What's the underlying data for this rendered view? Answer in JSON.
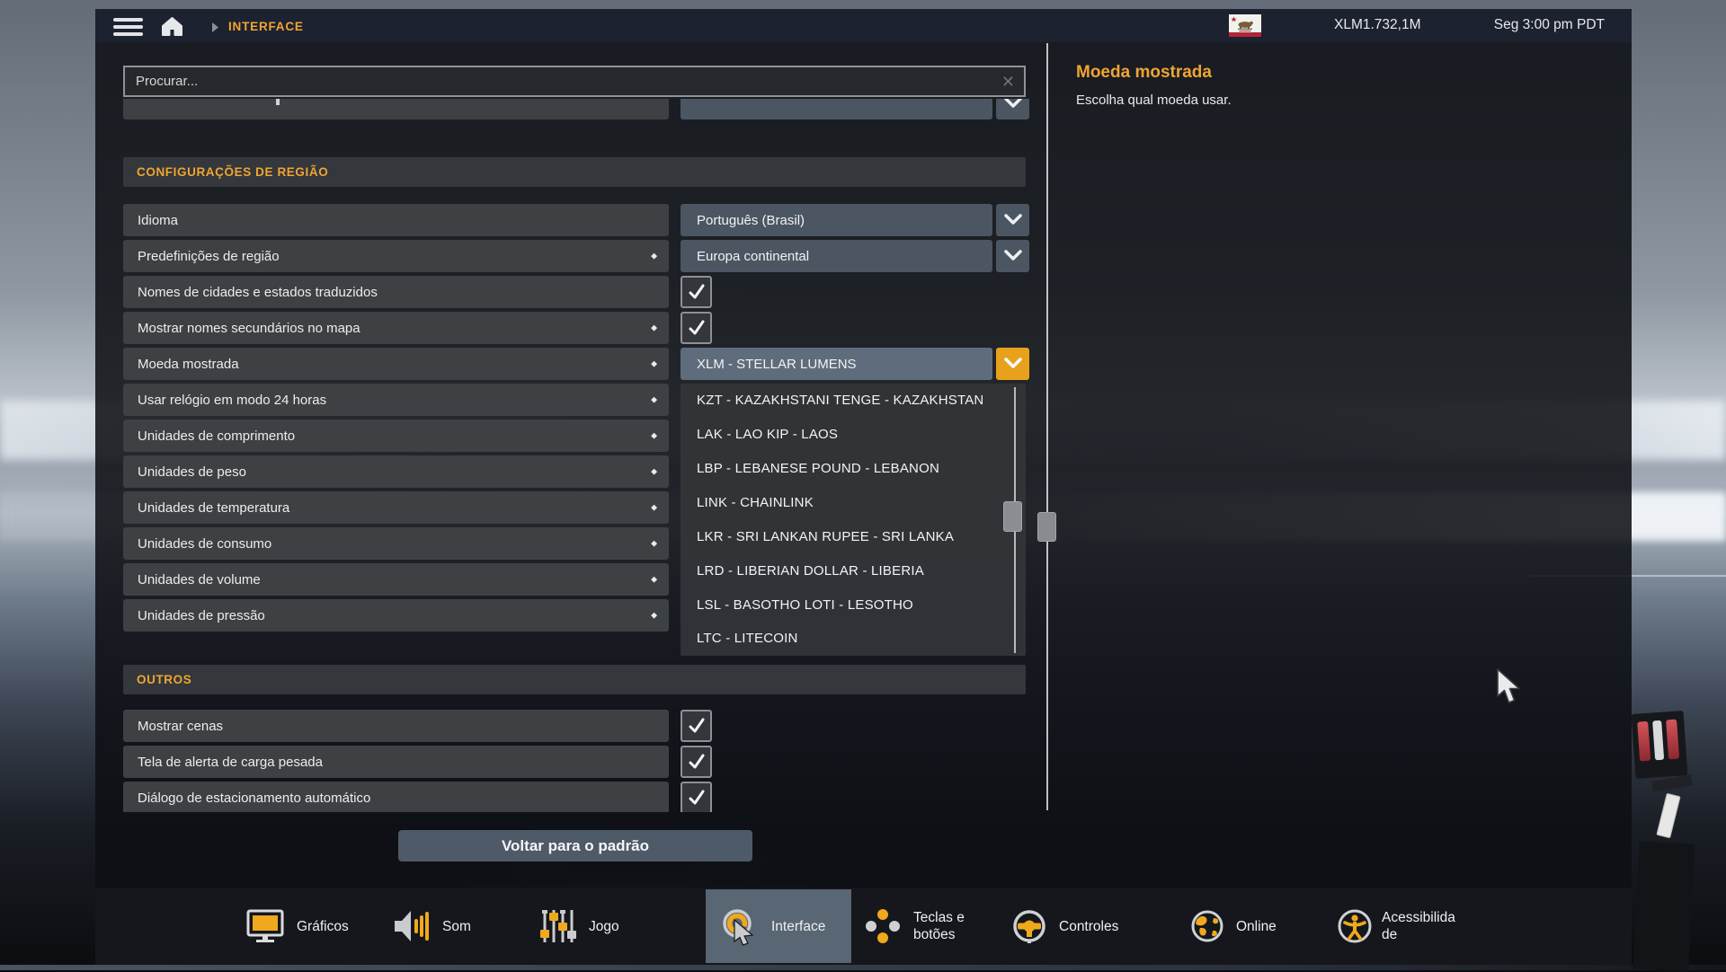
{
  "colors": {
    "accent_orange": "#f0a532",
    "dropdown_button_orange": "#e7a11b",
    "selected_value_bg": "#5f6c7b",
    "check_color": "#ffffff"
  },
  "icons": {
    "modified_marker": "◆",
    "clear_x": "✕"
  },
  "topbar": {
    "breadcrumb": "INTERFACE",
    "balance": "XLM1.732,1M",
    "clock": "Seg 3:00 pm PDT"
  },
  "search": {
    "placeholder": "Procurar..."
  },
  "region": {
    "title": "CONFIGURAÇÕES DE REGIÃO",
    "rows": [
      {
        "label": "Idioma",
        "value": "Português (Brasil)",
        "control": "dropdown"
      },
      {
        "label": "Predefinições de região",
        "value": "Europa continental",
        "control": "dropdown",
        "modified": true
      },
      {
        "label": "Nomes de cidades e estados traduzidos",
        "control": "checkbox",
        "checked": true
      },
      {
        "label": "Mostrar nomes secundários no mapa",
        "control": "checkbox",
        "checked": true,
        "modified": true
      },
      {
        "label": "Moeda mostrada",
        "value": "XLM - STELLAR LUMENS",
        "control": "dropdown-open",
        "modified": true
      },
      {
        "label": "Usar relógio em modo 24 horas",
        "modified": true
      },
      {
        "label": "Unidades de comprimento",
        "modified": true
      },
      {
        "label": "Unidades de peso",
        "modified": true
      },
      {
        "label": "Unidades de temperatura",
        "modified": true
      },
      {
        "label": "Unidades de consumo",
        "modified": true
      },
      {
        "label": "Unidades de volume",
        "modified": true
      },
      {
        "label": "Unidades de pressão",
        "modified": true
      }
    ]
  },
  "others": {
    "title": "OUTROS",
    "rows": [
      {
        "label": "Mostrar cenas",
        "control": "checkbox",
        "checked": true
      },
      {
        "label": "Tela de alerta de carga pesada",
        "control": "checkbox",
        "checked": true
      },
      {
        "label": "Diálogo de estacionamento automático",
        "control": "checkbox",
        "checked": true
      }
    ]
  },
  "currency": {
    "selected": "XLM - STELLAR LUMENS",
    "options": [
      "KZT - KAZAKHSTANI TENGE - KAZAKHSTAN",
      "LAK - LAO KIP - LAOS",
      "LBP - LEBANESE POUND - LEBANON",
      "LINK - CHAINLINK",
      "LKR - SRI LANKAN RUPEE - SRI LANKA",
      "LRD - LIBERIAN DOLLAR - LIBERIA",
      "LSL - BASOTHO LOTI - LESOTHO",
      "LTC - LITECOIN"
    ]
  },
  "actions": {
    "reset": "Voltar para o padrão"
  },
  "help": {
    "title": "Moeda mostrada",
    "description": "Escolha qual moeda usar."
  },
  "nav": {
    "items": [
      {
        "label": "Gráficos"
      },
      {
        "label": "Som"
      },
      {
        "label": "Jogo"
      },
      {
        "label": "Interface",
        "active": true
      },
      {
        "label": "Teclas e\nbotões"
      },
      {
        "label": "Controles"
      },
      {
        "label": "Online"
      },
      {
        "label": "Acessibilida\nde"
      }
    ]
  }
}
